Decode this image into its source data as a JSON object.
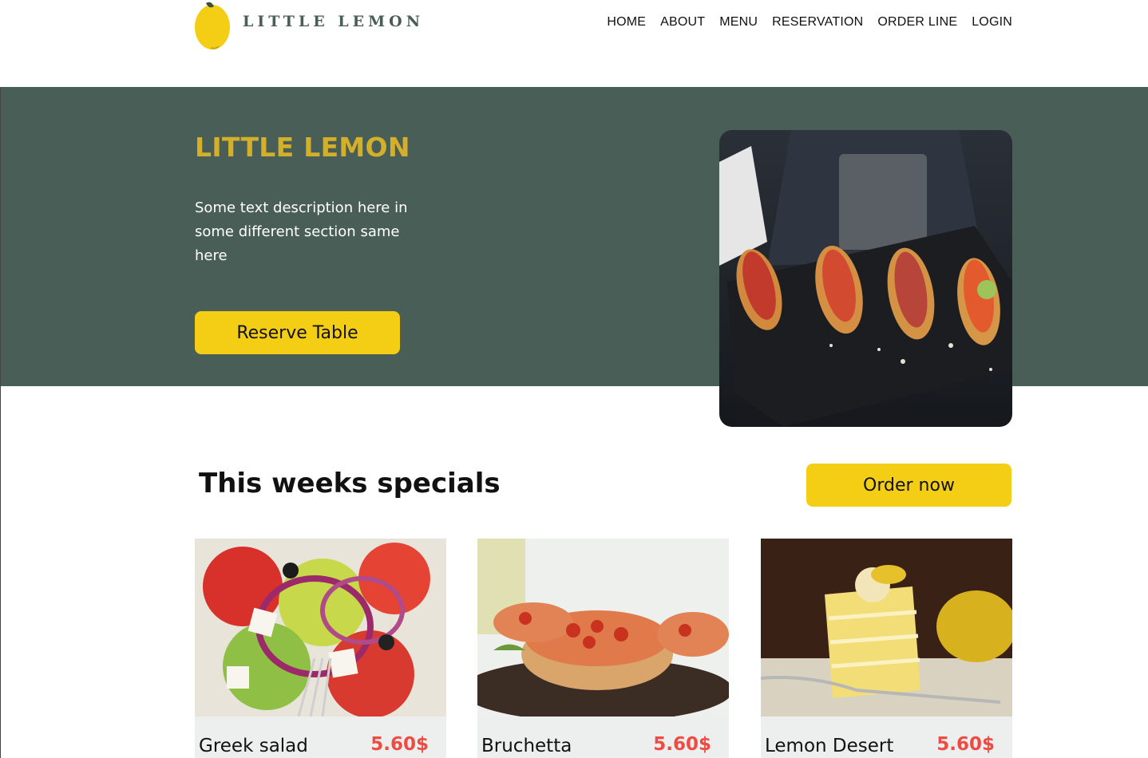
{
  "brand": {
    "logo_text": "LITTLE LEMON",
    "primary_color": "#495e57",
    "accent_color": "#f4ce14",
    "price_color": "#ee4b43",
    "logo_icon": "lemon-icon"
  },
  "nav": {
    "items": [
      {
        "label": "HOME"
      },
      {
        "label": "ABOUT"
      },
      {
        "label": "MENU"
      },
      {
        "label": "RESERVATION"
      },
      {
        "label": "ORDER LINE"
      },
      {
        "label": "LOGIN"
      }
    ]
  },
  "hero": {
    "title": "LITTLE LEMON",
    "description": "Some text description here in some different section same here",
    "reserve_label": "Reserve Table"
  },
  "specials": {
    "title": "This weeks specials",
    "order_label": "Order now",
    "items": [
      {
        "name": "Greek salad",
        "price": "5.60$"
      },
      {
        "name": "Bruchetta",
        "price": "5.60$"
      },
      {
        "name": "Lemon Desert",
        "price": "5.60$"
      }
    ]
  }
}
